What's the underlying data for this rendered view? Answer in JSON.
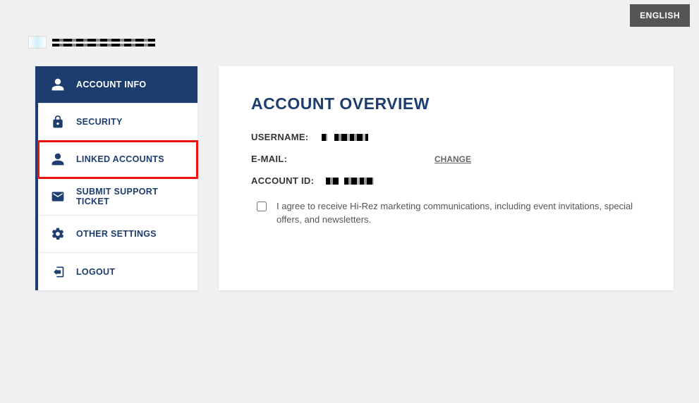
{
  "lang_button": "ENGLISH",
  "sidebar": {
    "items": [
      {
        "label": "ACCOUNT INFO"
      },
      {
        "label": "SECURITY"
      },
      {
        "label": "LINKED ACCOUNTS"
      },
      {
        "label": "SUBMIT SUPPORT TICKET"
      },
      {
        "label": "OTHER SETTINGS"
      },
      {
        "label": "LOGOUT"
      }
    ]
  },
  "panel": {
    "title": "ACCOUNT OVERVIEW",
    "username_label": "USERNAME:",
    "email_label": "E-MAIL:",
    "change_label": "CHANGE",
    "accountid_label": "ACCOUNT ID:",
    "consent_text": "I agree to receive Hi-Rez marketing communications, including event invitations, special offers, and newsletters."
  }
}
